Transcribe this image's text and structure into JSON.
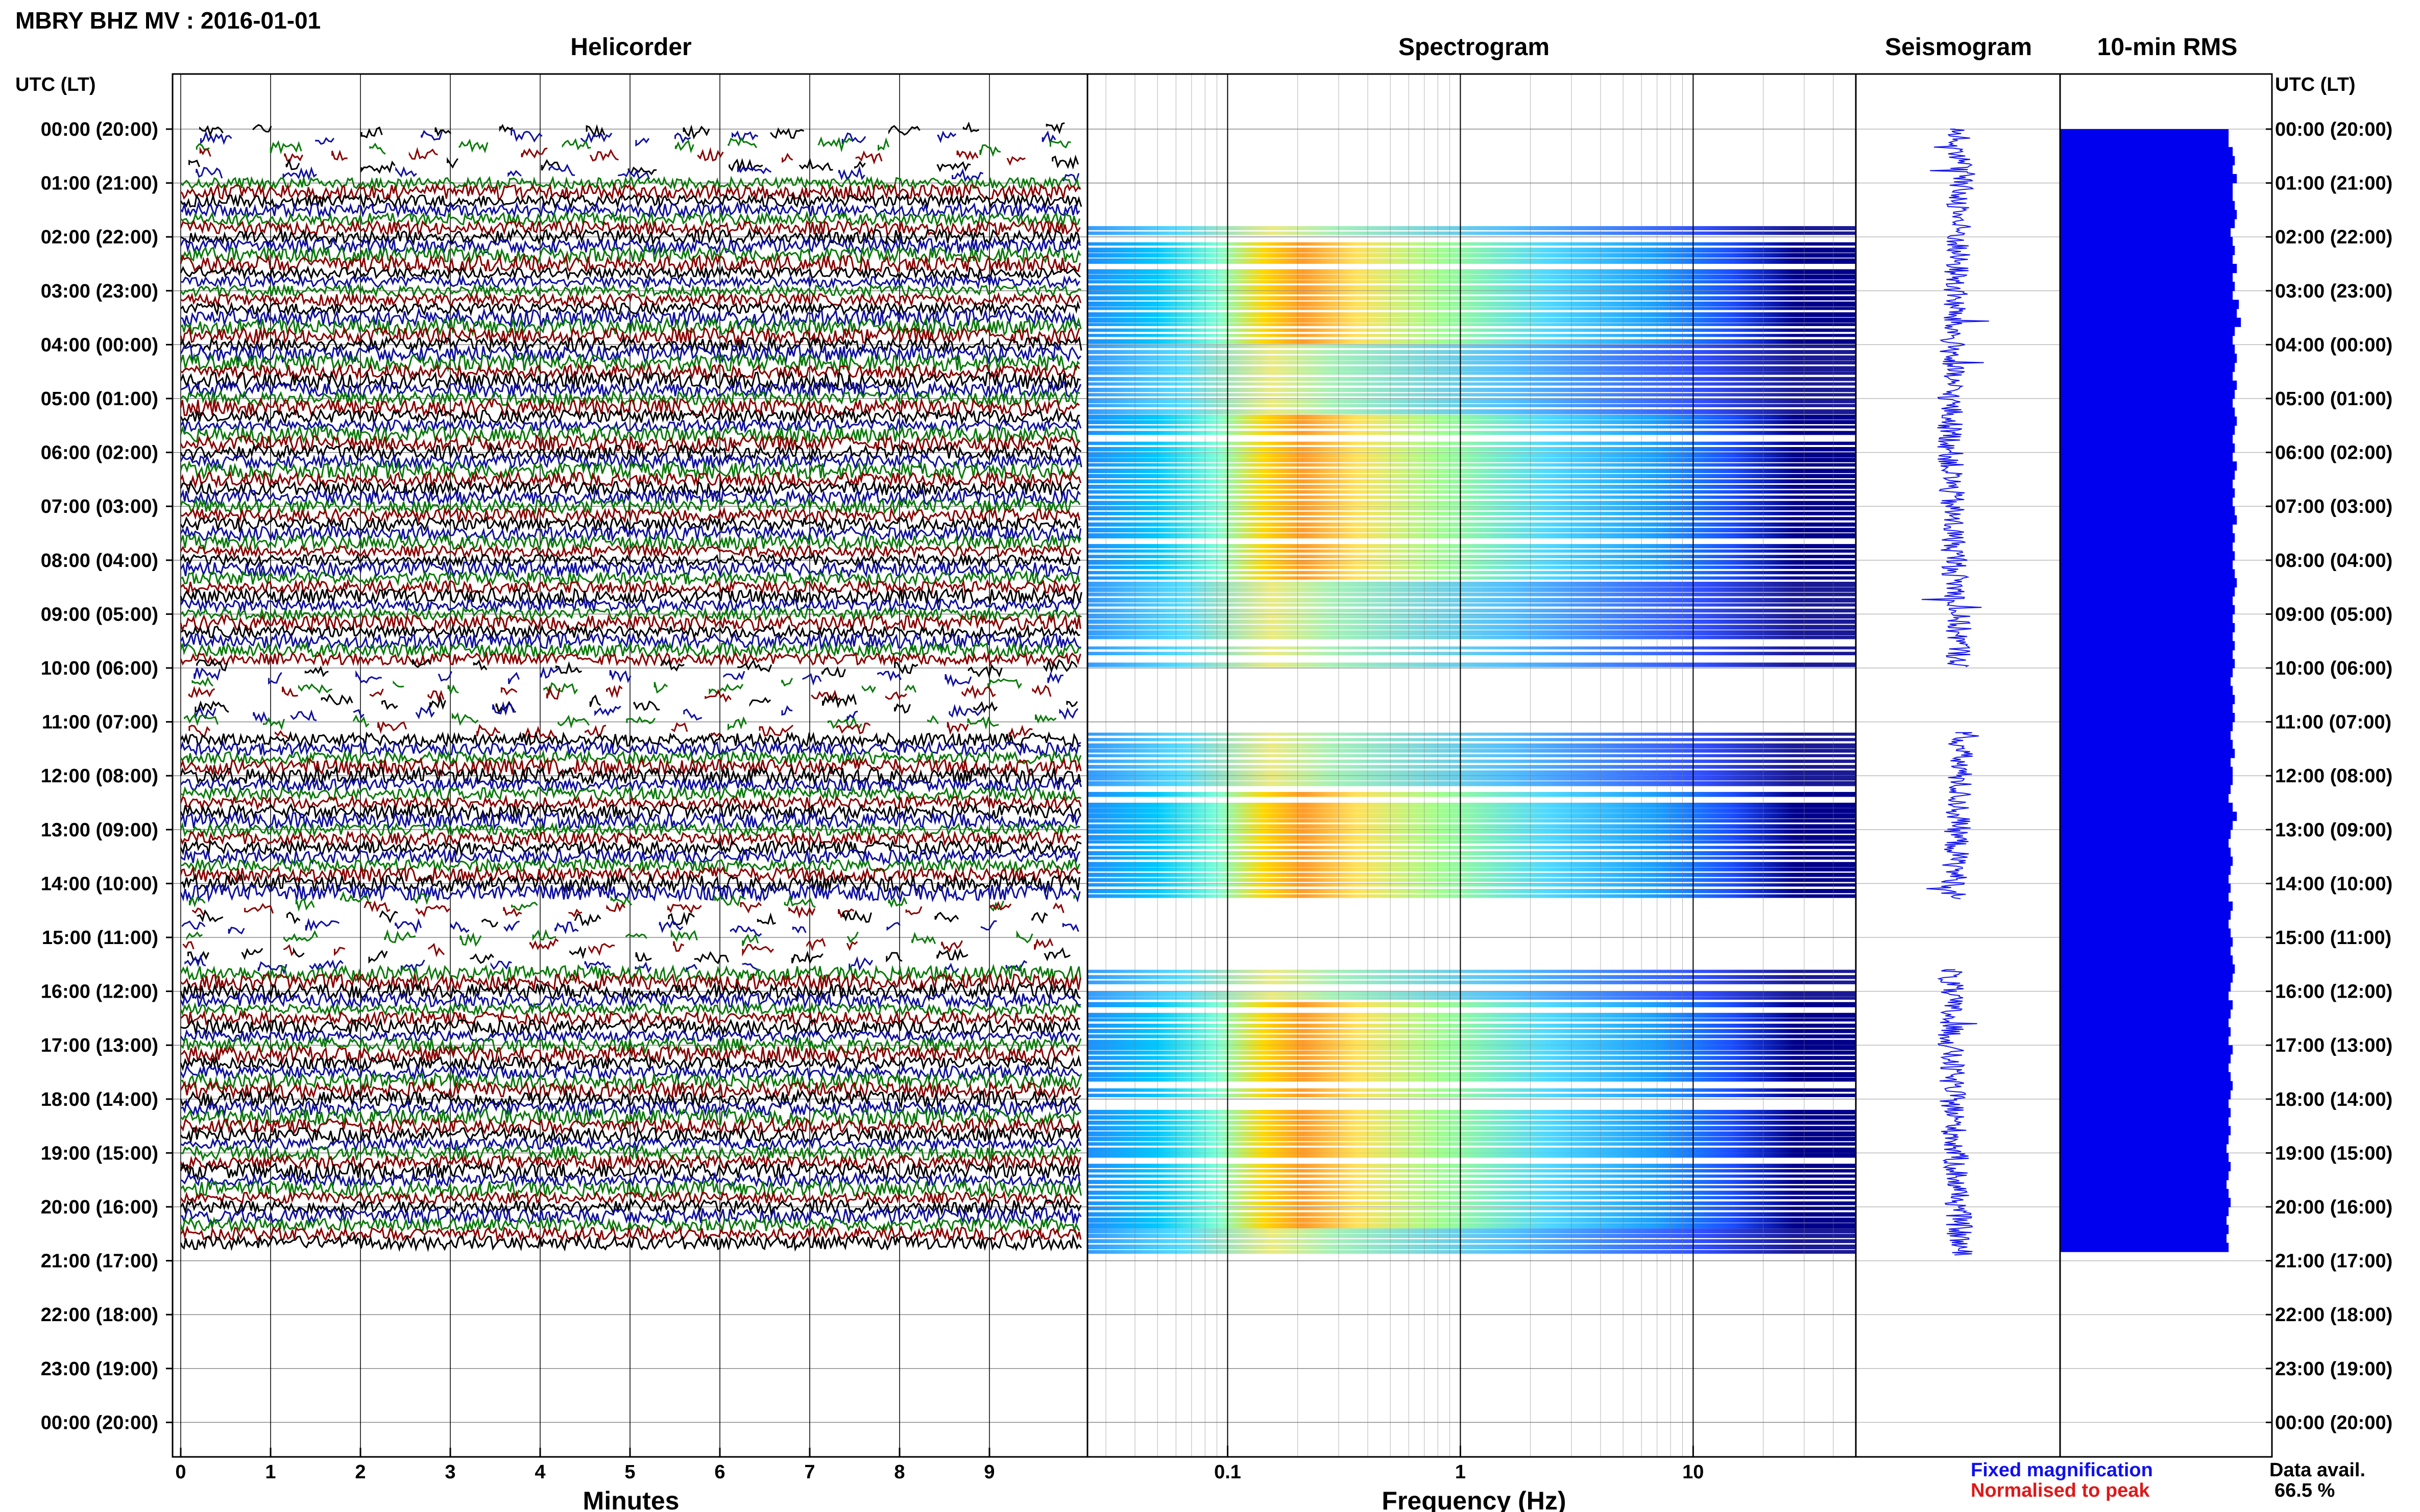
{
  "figure_title": "MBRY BHZ MV : 2016-01-01",
  "time_axis_label": "UTC (LT)",
  "time_labels": [
    "00:00 (20:00)",
    "01:00 (21:00)",
    "02:00 (22:00)",
    "03:00 (23:00)",
    "04:00 (00:00)",
    "05:00 (01:00)",
    "06:00 (02:00)",
    "07:00 (03:00)",
    "08:00 (04:00)",
    "09:00 (05:00)",
    "10:00 (06:00)",
    "11:00 (07:00)",
    "12:00 (08:00)",
    "13:00 (09:00)",
    "14:00 (10:00)",
    "15:00 (11:00)",
    "16:00 (12:00)",
    "17:00 (13:00)",
    "18:00 (14:00)",
    "19:00 (15:00)",
    "20:00 (16:00)",
    "21:00 (17:00)",
    "22:00 (18:00)",
    "23:00 (19:00)",
    "00:00 (20:00)"
  ],
  "legend": {
    "fixed": "Fixed magnification",
    "normalised": "Normalised to peak",
    "data_avail_label": "Data avail.",
    "data_avail_value": "66.5 %"
  },
  "colors": {
    "trace_cycle": [
      "#000000",
      "#1010a0",
      "#0a7a0a",
      "#8b0000"
    ],
    "seismogram": "#1515ee",
    "rms": "#0000ee",
    "spectro_low": "#00008b",
    "spectro_high": "#ffff00"
  },
  "chart_data": [
    {
      "name": "helicorder",
      "type": "line",
      "title": "Helicorder",
      "xlabel": "Minutes",
      "xticks": [
        "0",
        "1",
        "2",
        "3",
        "4",
        "5",
        "6",
        "7",
        "8",
        "9"
      ],
      "xlim": [
        0,
        10
      ],
      "trace_interval_minutes": 10,
      "data_end_hours": 20.9,
      "data_gaps_hours": [
        [
          10.0,
          11.2
        ],
        [
          14.3,
          15.6
        ]
      ]
    },
    {
      "name": "spectrogram",
      "type": "heatmap",
      "title": "Spectrogram",
      "xlabel": "Frequency (Hz)",
      "xticks": [
        "0.1",
        "1",
        "10"
      ],
      "xscale": "log",
      "xlim": [
        0.025,
        50
      ],
      "data_segments_hours": [
        [
          1.7,
          10.0
        ],
        [
          11.2,
          14.3
        ],
        [
          15.6,
          20.9
        ]
      ]
    },
    {
      "name": "seismogram",
      "type": "line",
      "title": "Seismogram",
      "data_segments_hours": [
        [
          0.0,
          10.0
        ],
        [
          11.2,
          14.3
        ],
        [
          15.6,
          20.9
        ]
      ]
    },
    {
      "name": "rms",
      "type": "bar",
      "title": "10-min RMS",
      "bin_minutes": 10,
      "values": [
        0.82,
        0.82,
        0.84,
        0.85,
        0.84,
        0.86,
        0.84,
        0.84,
        0.85,
        0.86,
        0.85,
        0.83,
        0.84,
        0.85,
        0.84,
        0.86,
        0.84,
        0.85,
        0.84,
        0.87,
        0.86,
        0.88,
        0.85,
        0.84,
        0.85,
        0.86,
        0.85,
        0.84,
        0.86,
        0.85,
        0.84,
        0.85,
        0.86,
        0.85,
        0.84,
        0.85,
        0.84,
        0.86,
        0.85,
        0.84,
        0.85,
        0.84,
        0.85,
        0.86,
        0.84,
        0.85,
        0.84,
        0.85,
        0.84,
        0.85,
        0.86,
        0.85,
        0.84,
        0.85,
        0.84,
        0.85,
        0.84,
        0.85,
        0.84,
        0.85,
        0.84,
        0.83,
        0.84,
        0.85,
        0.84,
        0.85,
        0.84,
        0.83,
        0.84,
        0.85,
        0.83,
        0.84,
        0.84,
        0.83,
        0.82,
        0.84,
        0.86,
        0.84,
        0.83,
        0.82,
        0.83,
        0.84,
        0.83,
        0.82,
        0.83,
        0.82,
        0.84,
        0.83,
        0.82,
        0.83,
        0.84,
        0.83,
        0.84,
        0.85,
        0.84,
        0.83,
        0.82,
        0.84,
        0.83,
        0.82,
        0.83,
        0.82,
        0.84,
        0.83,
        0.82,
        0.83,
        0.84,
        0.83,
        0.82,
        0.83,
        0.82,
        0.83,
        0.82,
        0.81,
        0.82,
        0.83,
        0.82,
        0.81,
        0.82,
        0.83,
        0.82,
        0.81,
        0.82,
        0.81,
        0.82
      ]
    }
  ]
}
